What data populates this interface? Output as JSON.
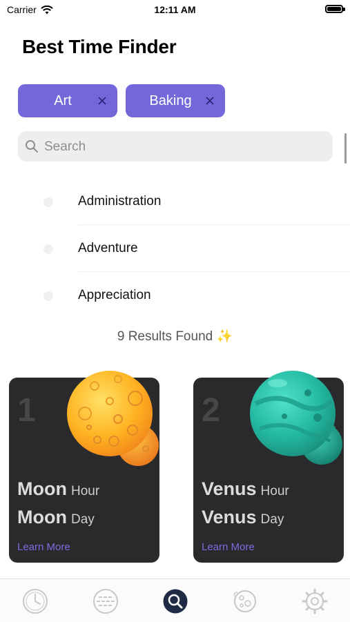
{
  "status_bar": {
    "carrier": "Carrier",
    "time": "12:11 AM"
  },
  "page_title": "Best Time Finder",
  "chips": [
    {
      "label": "Art"
    },
    {
      "label": "Baking"
    }
  ],
  "search": {
    "placeholder": "Search",
    "value": ""
  },
  "list": [
    {
      "label": "Administration"
    },
    {
      "label": "Adventure"
    },
    {
      "label": "Appreciation"
    }
  ],
  "results_text": "9 Results Found ✨",
  "cards": [
    {
      "rank": "1",
      "hour_planet": "Moon",
      "hour_word": "Hour",
      "day_planet": "Moon",
      "day_word": "Day",
      "link": "Learn More",
      "icon": "moon-planet-icon"
    },
    {
      "rank": "2",
      "hour_planet": "Venus",
      "hour_word": "Hour",
      "day_planet": "Venus",
      "day_word": "Day",
      "link": "Learn More",
      "icon": "venus-planet-icon"
    }
  ],
  "tabs": [
    {
      "icon": "clock-icon"
    },
    {
      "icon": "list-icon"
    },
    {
      "icon": "search-icon",
      "active": true
    },
    {
      "icon": "planet-icon"
    },
    {
      "icon": "gear-icon"
    }
  ],
  "colors": {
    "accent": "#7467d9",
    "card_bg": "#2a2a2c",
    "link": "#7a6de0",
    "tab_active": "#1f2a44",
    "tab_inactive": "#c7c7cc"
  }
}
